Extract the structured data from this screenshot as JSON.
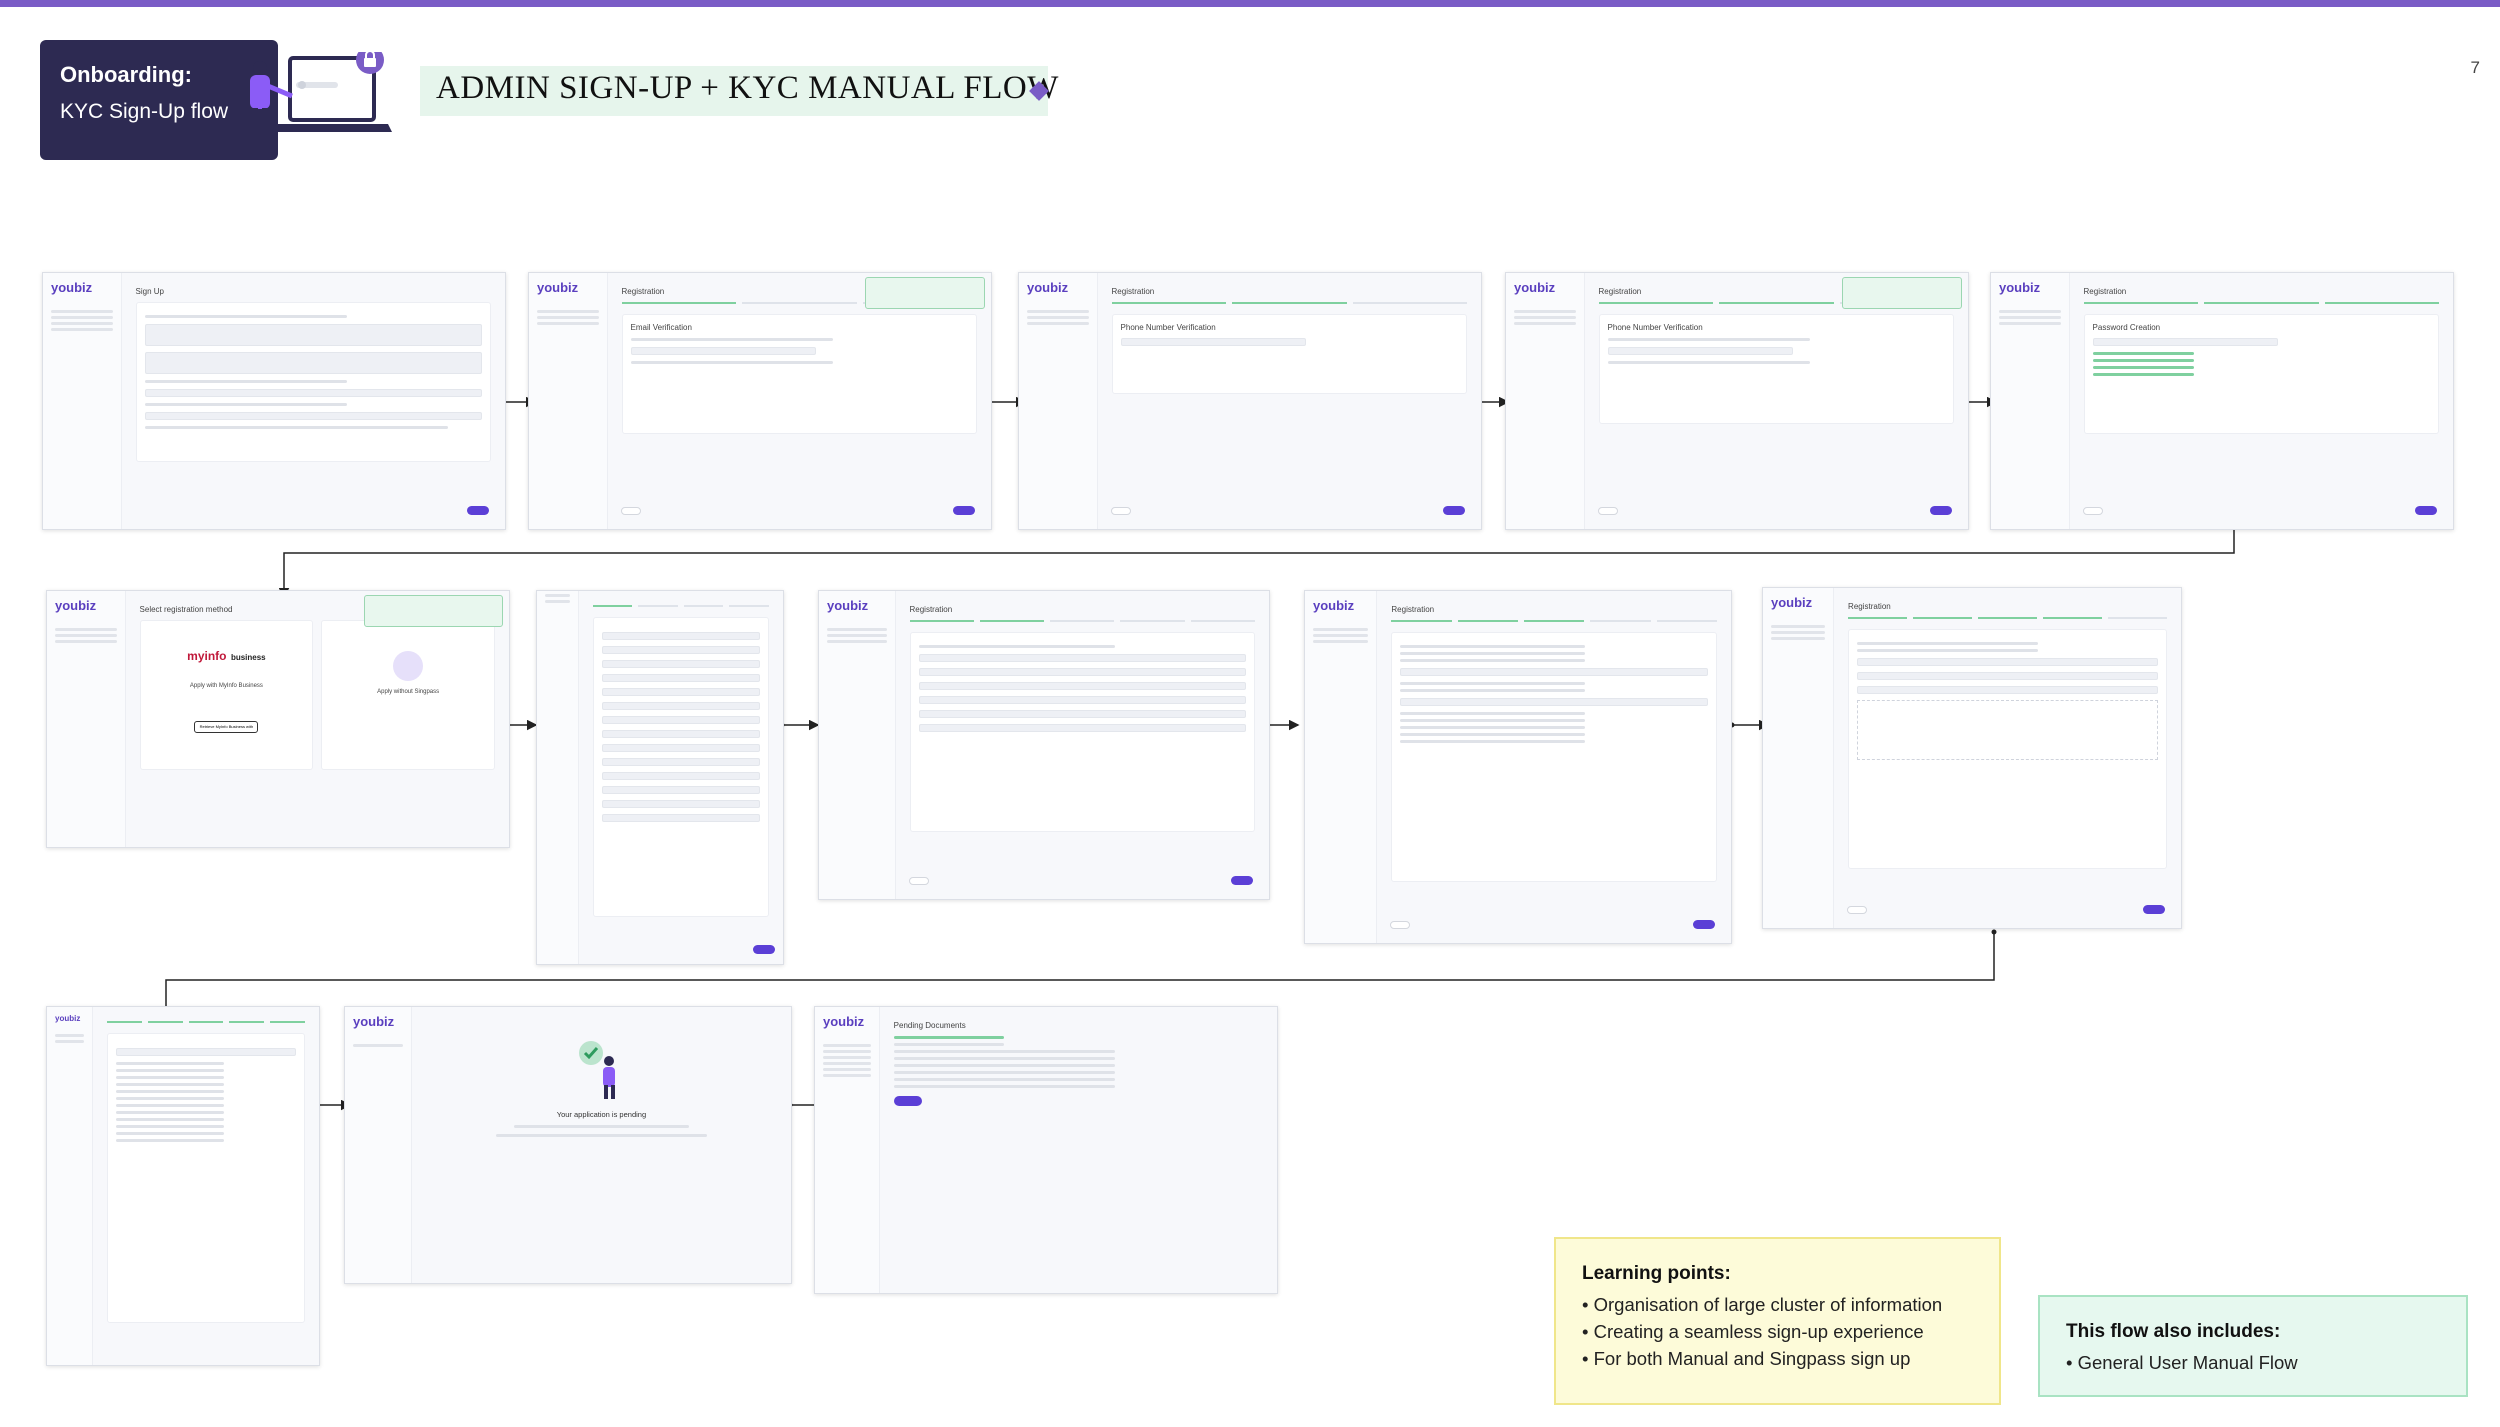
{
  "page_number": "7",
  "badge": {
    "line1": "Onboarding:",
    "line2": "KYC Sign-Up flow"
  },
  "title": "ADMIN SIGN-UP + KYC MANUAL FLOW",
  "screens": {
    "logo": "youbiz",
    "sign_up": "Sign Up",
    "registration": "Registration",
    "email_verification": "Email Verification",
    "phone_verification": "Phone Number Verification",
    "password_creation": "Password Creation",
    "select_method": "Select registration method",
    "myinfo": "myinfo",
    "myinfo_business": "business",
    "apply_singpass": "Apply with MyInfo Business",
    "apply_manual": "Apply without Singpass",
    "singpass_button": "Retrieve MyInfo Business with Singpass",
    "pending_title": "Your application is pending",
    "pending_docs": "Pending Documents"
  },
  "learning": {
    "heading": "Learning points:",
    "items": [
      "• Organisation of large cluster of information",
      "• Creating a seamless sign-up experience",
      "• For both Manual and Singpass sign up"
    ]
  },
  "also": {
    "heading": "This flow also includes:",
    "items": [
      "• General User Manual Flow"
    ]
  },
  "colors": {
    "accent": "#7a5cc6",
    "dark": "#2d2a52",
    "button": "#5b3fd6",
    "success": "#7fd09f"
  }
}
